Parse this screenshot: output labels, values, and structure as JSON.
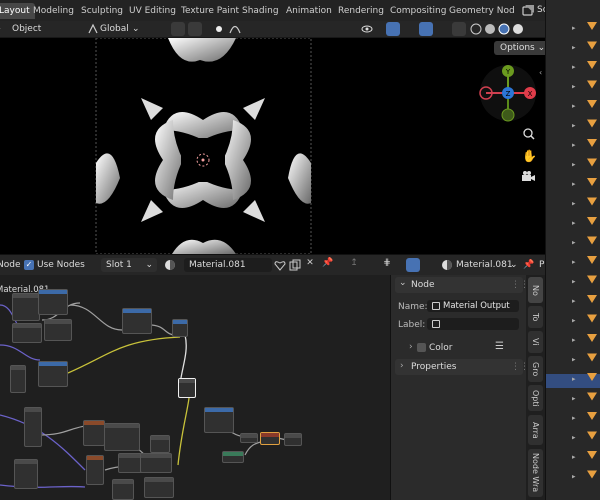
{
  "topbar": {
    "tabs": [
      "Layout",
      "Modeling",
      "Sculpting",
      "UV Editing",
      "Texture Paint",
      "Shading",
      "Animation",
      "Rendering",
      "Compositing",
      "Geometry Nod"
    ],
    "scene_label": "Scene"
  },
  "viewport_header": {
    "mode": "Object",
    "transform_orientation": "Global",
    "options_label": "Options"
  },
  "gizmo": {
    "x_label": "X",
    "y_label": "Y",
    "z_label": "Z"
  },
  "node_header": {
    "node_menu": "Node",
    "use_nodes_label": "Use Nodes",
    "use_nodes_checked": true,
    "slot": "Slot 1",
    "material_name": "Material.081",
    "material_name_right": "Material.081",
    "pin_label": "P"
  },
  "node_editor": {
    "breadcrumb": "Material.081"
  },
  "npanel": {
    "section_node": "Node",
    "name_label": "Name:",
    "name_value": "Material Output",
    "label_label": "Label:",
    "label_value": "",
    "color_label": "Color",
    "properties_label": "Properties"
  },
  "npanel_tabs": [
    "No",
    "To",
    "Vi",
    "Gro",
    "Opti",
    "Arra",
    "Node Wra"
  ],
  "colors": {
    "accent": "#4772b3",
    "selected_row": "#334d80",
    "x_axis": "#e03c4a",
    "y_axis": "#6b9a1f",
    "z_axis": "#2c76d6",
    "link_yellow": "#c8c23a",
    "link_purple": "#6b62c9",
    "link_grey": "#a0a0a0"
  }
}
